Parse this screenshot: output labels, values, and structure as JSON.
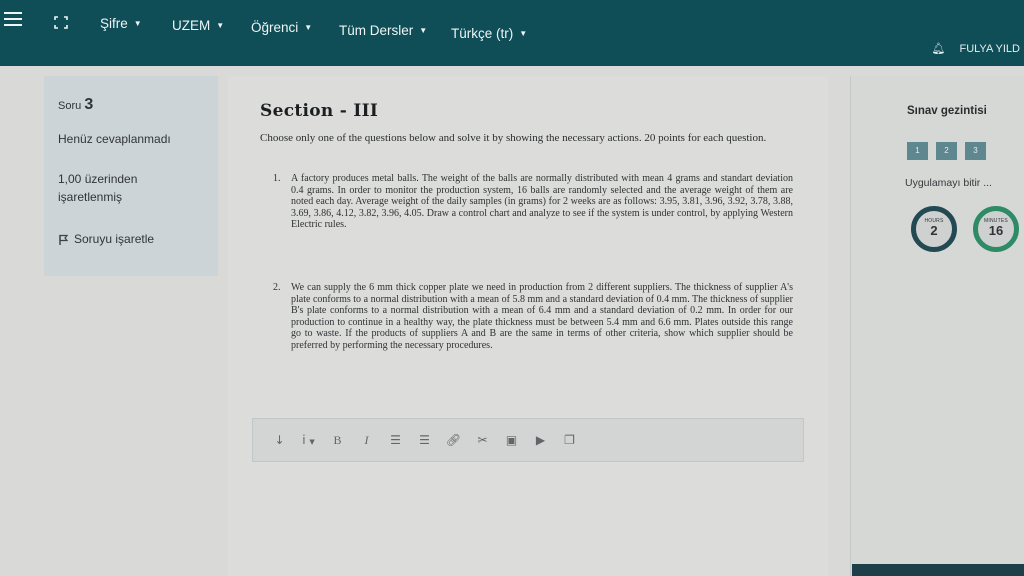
{
  "navbar": {
    "menu_items": [
      {
        "label": "Şifre"
      },
      {
        "label": "UZEM"
      },
      {
        "label": "Öğrenci"
      },
      {
        "label": "Tüm Dersler"
      },
      {
        "label": "Türkçe (tr)"
      }
    ],
    "user_name": "FULYA YILD"
  },
  "question_info": {
    "label": "Soru",
    "number": "3",
    "status": "Henüz cevaplanmadı",
    "grade_line1": "1,00 üzerinden",
    "grade_line2": "işaretlenmiş",
    "flag_label": "Soruyu işaretle"
  },
  "content": {
    "section_title": "Section - III",
    "intro": "Choose only one of the questions below and solve it by showing the necessary actions. 20 points for each question.",
    "questions": [
      {
        "num": "1.",
        "text": "A factory produces metal balls. The weight of the balls are normally distributed with mean 4 grams and standart deviation 0.4 grams. In order to monitor the production system, 16 balls are randomly selected and the average weight of them are noted each day. Average weight of the daily samples (in grams) for 2 weeks are as follows: 3.95, 3.81, 3.96, 3.92, 3.78, 3.88, 3.69, 3.86, 4.12, 3.82, 3.96, 4.05. Draw a control chart and analyze to see if the system is under control, by applying Western Electric rules."
      },
      {
        "num": "2.",
        "text": "We can supply the 6 mm thick copper plate we need in production from 2 different suppliers. The thickness of supplier A's plate conforms to a normal distribution with a mean of 5.8 mm and a standard deviation of 0.4 mm. The thickness of supplier B's plate conforms to a normal distribution with a mean of 6.4 mm and a standard deviation of 0.2 mm. In order for our production to continue in a healthy way, the plate thickness must be between 5.4 mm and 6.6 mm. Plates outside this range go to waste. If the products of suppliers A and B are the same in terms of other criteria, show which supplier should be preferred by performing the necessary procedures."
      }
    ]
  },
  "editor_toolbar": {
    "bold": "B",
    "italic": "I",
    "info": "i"
  },
  "exam_nav": {
    "title": "Sınav gezintisi",
    "question_buttons": [
      "1",
      "2",
      "3"
    ],
    "finish_label": "Uygulamayı bitir ...",
    "timer": {
      "hours_label": "HOURS",
      "hours": "2",
      "minutes_label": "MINUTES",
      "minutes": "16"
    }
  }
}
